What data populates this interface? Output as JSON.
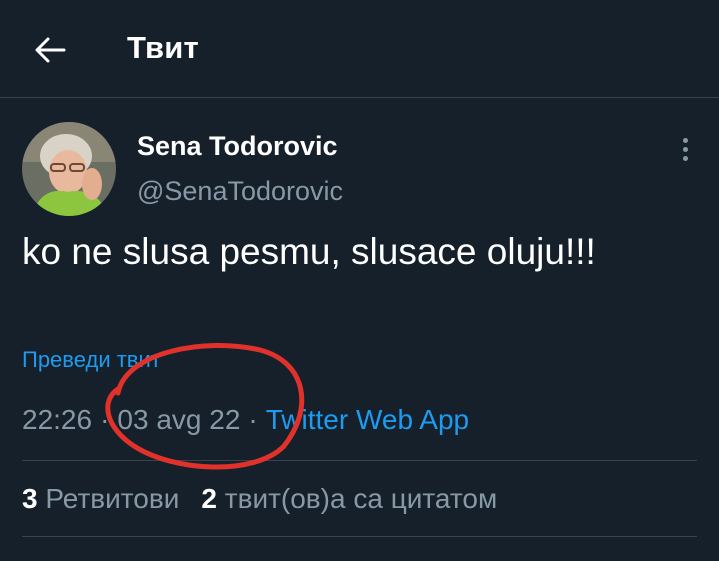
{
  "header": {
    "title": "Твит"
  },
  "tweet": {
    "author_name": "Sena Todorovic",
    "author_handle": "@SenaTodorovic",
    "text": "ko ne slusa pesmu, slusace oluju!!!",
    "translate_label": "Преведи твит",
    "time": "22:26",
    "date": "03 avg 22",
    "separator": "·",
    "source_app": "Twitter Web App"
  },
  "stats": {
    "retweets_count": "3",
    "retweets_label": "Ретвитови",
    "quotes_count": "2",
    "quotes_label": "твит(ов)а са цитатом"
  },
  "icons": {
    "back": "arrow-left-icon",
    "more": "more-vertical-icon"
  },
  "colors": {
    "background": "#15202b",
    "accent": "#1d9bf0",
    "secondary_text": "#8899a6",
    "annotation": "#e0322b"
  }
}
